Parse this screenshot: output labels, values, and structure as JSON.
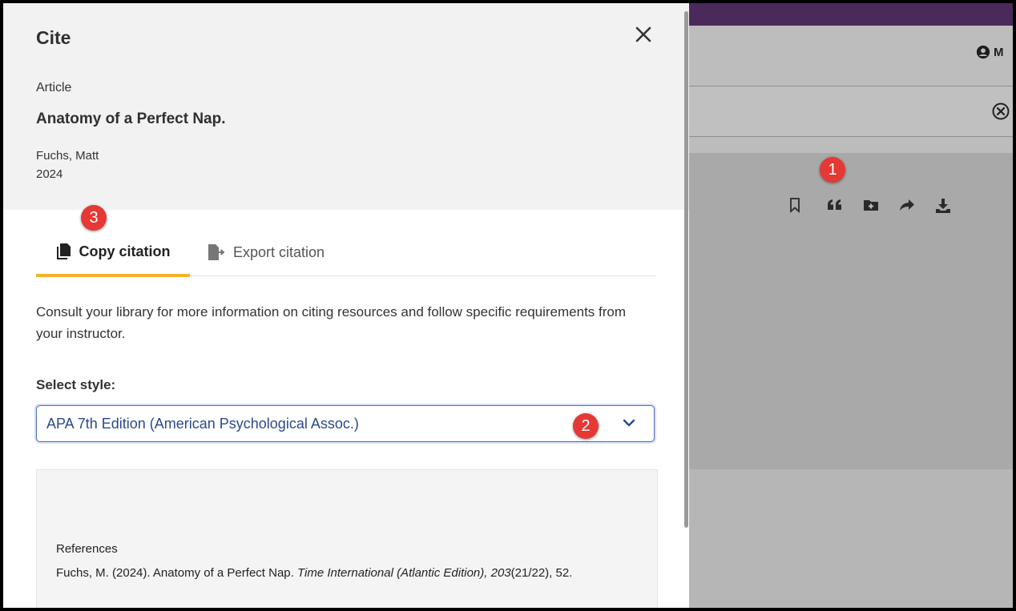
{
  "dialog": {
    "title": "Cite",
    "close_icon": "close-icon",
    "item": {
      "type": "Article",
      "title": "Anatomy of a Perfect Nap.",
      "author": "Fuchs, Matt",
      "year": "2024"
    },
    "tabs": [
      {
        "label": "Copy citation",
        "icon": "copy-icon",
        "active": true
      },
      {
        "label": "Export citation",
        "icon": "export-icon",
        "active": false
      }
    ],
    "consult_text": "Consult your library for more information on citing resources and follow specific requirements from your instructor.",
    "style_label": "Select style:",
    "style_value": "APA 7th Edition (American Psychological Assoc.)",
    "references_heading": "References",
    "citation": {
      "part1": "Fuchs, M. (2024). Anatomy of a Perfect Nap. ",
      "source_italic": "Time International (Atlantic Edition), 203",
      "part2": "(21/22), 52."
    }
  },
  "background": {
    "account_label": "M",
    "toolbar_icons": [
      "bookmark-icon",
      "cite-icon",
      "add-folder-icon",
      "share-icon",
      "download-icon"
    ]
  },
  "markers": [
    "1",
    "2",
    "3"
  ],
  "colors": {
    "accent_tab": "#f2b32d",
    "select_border": "#4f6fb8",
    "select_text": "#2a4a8a",
    "marker": "#e53935",
    "top_bar": "#4a2a5a"
  }
}
